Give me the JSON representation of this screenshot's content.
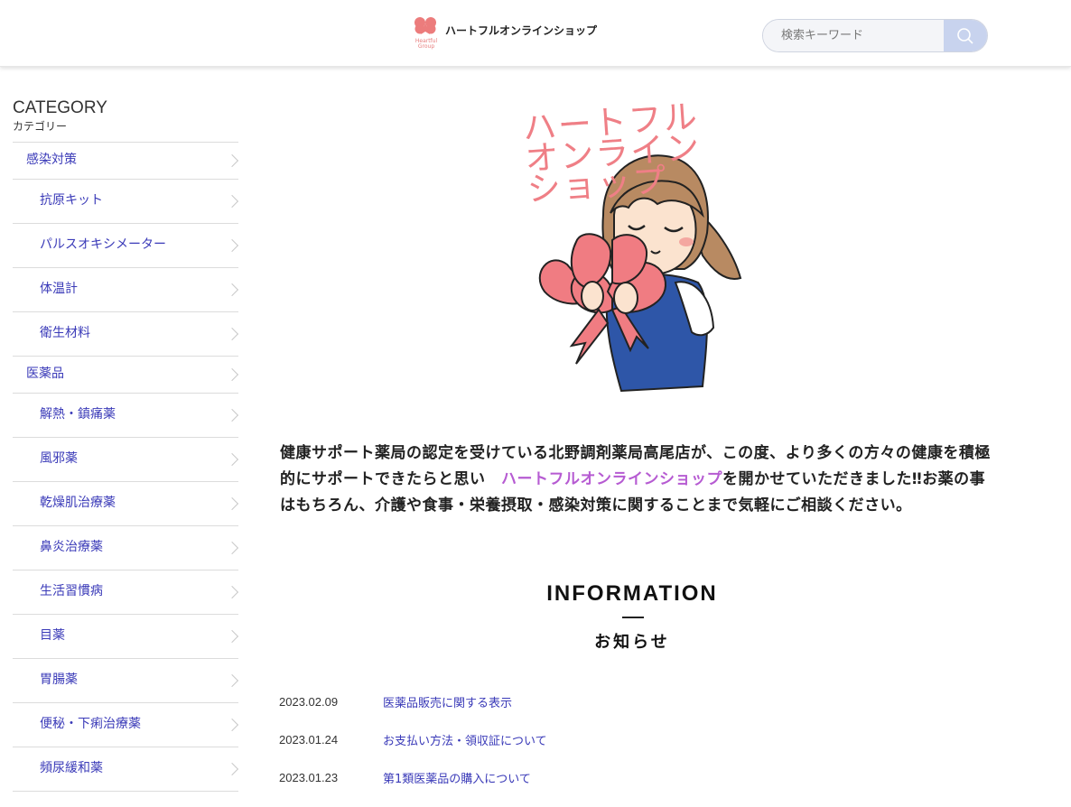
{
  "header": {
    "logo_text": "ハートフルオンラインショップ",
    "logo_sub_line1": "Heartful",
    "logo_sub_line2": "Group",
    "search_placeholder": "検索キーワード",
    "brand_color": "#e77d7d",
    "search_button_color": "#c8d3ee",
    "search_icon": "search-icon"
  },
  "sidebar": {
    "title": "CATEGORY",
    "subtitle": "カテゴリー",
    "items": [
      {
        "label": "感染対策",
        "level": "parent"
      },
      {
        "label": "抗原キット",
        "level": "child"
      },
      {
        "label": "パルスオキシメーター",
        "level": "child"
      },
      {
        "label": "体温計",
        "level": "child"
      },
      {
        "label": "衛生材料",
        "level": "child"
      },
      {
        "label": "医薬品",
        "level": "parent"
      },
      {
        "label": "解熱・鎮痛薬",
        "level": "child"
      },
      {
        "label": "風邪薬",
        "level": "child"
      },
      {
        "label": "乾燥肌治療薬",
        "level": "child"
      },
      {
        "label": "鼻炎治療薬",
        "level": "child"
      },
      {
        "label": "生活習慣病",
        "level": "child"
      },
      {
        "label": "目薬",
        "level": "child"
      },
      {
        "label": "胃腸薬",
        "level": "child"
      },
      {
        "label": "便秘・下痢治療薬",
        "level": "child"
      },
      {
        "label": "頻尿緩和薬",
        "level": "child"
      }
    ]
  },
  "hero": {
    "title": "ハートフルオンラインショップ",
    "title_color": "#ef7f86"
  },
  "intro": {
    "text_1": "健康サポート薬局の認定を受けている北野調剤薬局高尾店が、この度、より多くの方々の健康を積極的にサポートできたらと思い　",
    "link": "ハートフルオンラインショップ",
    "text_2": "を開かせていただきました‼お薬の事はもちろん、介護や食事・栄養摂取・感染対策に関することまで気軽にご相談ください。",
    "link_color": "#b65bd2"
  },
  "information": {
    "title": "INFORMATION",
    "subtitle": "お知らせ",
    "news": [
      {
        "date": "2023.02.09",
        "title": "医薬品販売に関する表示"
      },
      {
        "date": "2023.01.24",
        "title": "お支払い方法・領収証について"
      },
      {
        "date": "2023.01.23",
        "title": "第1類医薬品の購入について"
      }
    ]
  }
}
